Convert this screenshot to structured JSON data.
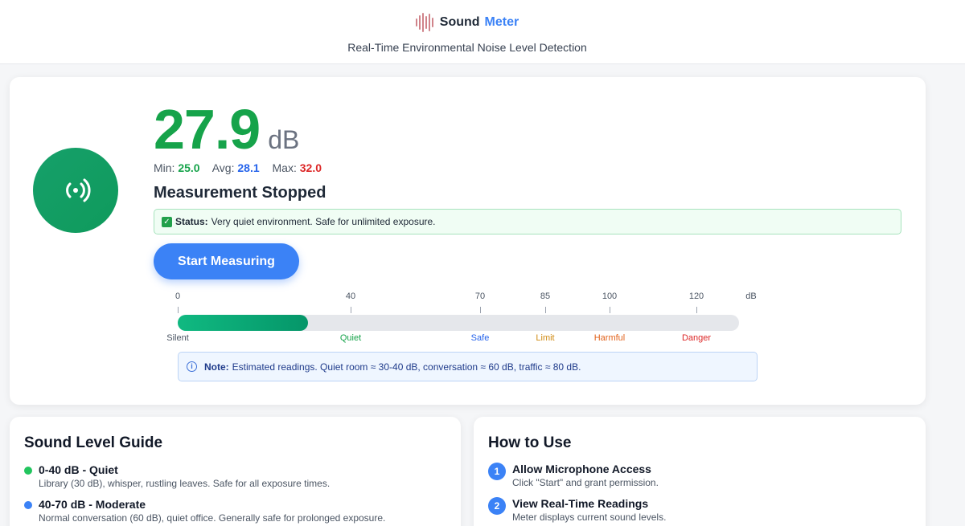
{
  "header": {
    "brand_name": "Sound",
    "brand_accent": "Meter",
    "subtitle": "Real-Time Environmental Noise Level Detection"
  },
  "meter": {
    "value": "27.9",
    "unit": "dB",
    "min_label": "Min:",
    "min_value": "25.0",
    "avg_label": "Avg:",
    "avg_value": "28.1",
    "max_label": "Max:",
    "max_value": "32.0",
    "state": "Measurement Stopped",
    "status_label": "Status:",
    "status_text": "Very quiet environment. Safe for unlimited exposure.",
    "button_label": "Start Measuring",
    "level_fraction": 0.2325,
    "mic_icon": "radio-waves-icon"
  },
  "scale": {
    "ticks": [
      "0",
      "40",
      "70",
      "85",
      "100",
      "120"
    ],
    "unit_label": "dB",
    "zones": [
      "Silent",
      "Quiet",
      "Safe",
      "Limit",
      "Harmful",
      "Danger"
    ],
    "zone_colors": [
      "#4b5563",
      "#16a34a",
      "#2563eb",
      "#d08a12",
      "#e2621b",
      "#dc2626"
    ]
  },
  "note": {
    "label": "Note:",
    "text": "Estimated readings. Quiet room ≈ 30-40 dB, conversation ≈ 60 dB, traffic ≈ 80 dB."
  },
  "guide": {
    "title": "Sound Level Guide",
    "items": [
      {
        "heading": "0-40 dB - Quiet",
        "description": "Library (30 dB), whisper, rustling leaves. Safe for all exposure times.",
        "color": "#22c55e"
      },
      {
        "heading": "40-70 dB - Moderate",
        "description": "Normal conversation (60 dB), quiet office. Generally safe for prolonged exposure.",
        "color": "#3b82f6"
      }
    ]
  },
  "howto": {
    "title": "How to Use",
    "steps": [
      {
        "number": "1",
        "heading": "Allow Microphone Access",
        "description": "Click \"Start\" and grant permission."
      },
      {
        "number": "2",
        "heading": "View Real-Time Readings",
        "description": "Meter displays current sound levels."
      }
    ]
  }
}
